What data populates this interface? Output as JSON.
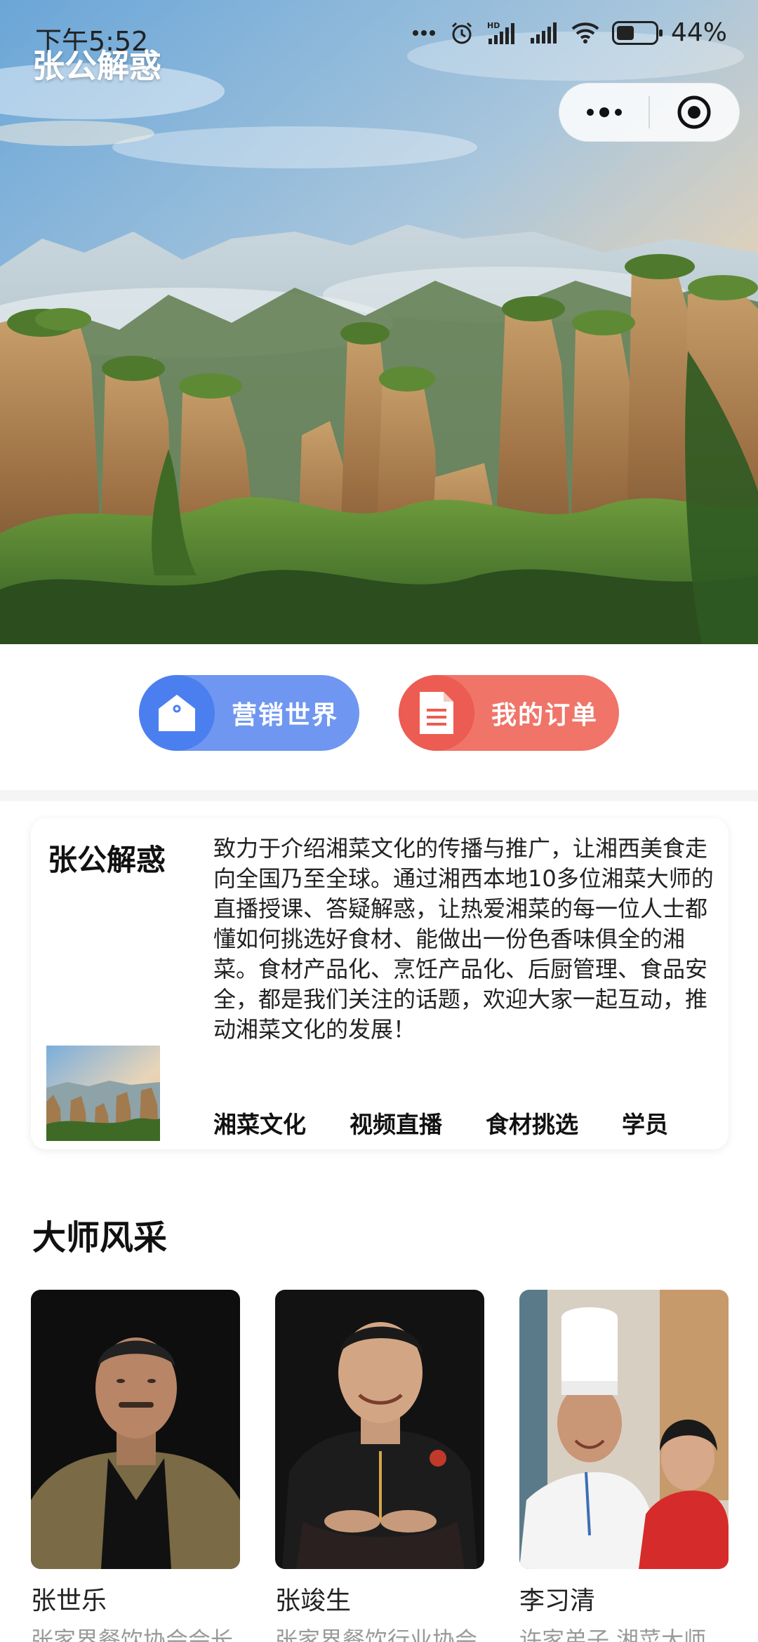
{
  "status_bar": {
    "time": "下午5:52",
    "battery": "44%",
    "network_label": "HD"
  },
  "app": {
    "title": "张公解惑"
  },
  "actions": [
    {
      "label": "营销世界",
      "icon": "tag-icon",
      "color": "#6f97f1"
    },
    {
      "label": "我的订单",
      "icon": "document-icon",
      "color": "#f07468"
    }
  ],
  "intro": {
    "name": "张公解惑",
    "text": "致力于介绍湘菜文化的传播与推广，让湘西美食走向全国乃至全球。通过湘西本地10多位湘菜大师的直播授课、答疑解惑，让热爱湘菜的每一位人士都懂如何挑选好食材、能做出一份色香味俱全的湘菜。食材产品化、烹饪产品化、后厨管理、食品安全，都是我们关注的话题，欢迎大家一起互动，推动湘菜文化的发展！",
    "tags": [
      "湘菜文化",
      "视频直播",
      "食材挑选",
      "学员"
    ]
  },
  "masters_section": {
    "title": "大师风采",
    "items": [
      {
        "name": "张世乐",
        "desc": "张家界餐饮协会会长"
      },
      {
        "name": "张竣生",
        "desc": "张家界餐饮行业协会"
      },
      {
        "name": "李习清",
        "desc": "许家弟子 湘菜大师"
      }
    ]
  }
}
